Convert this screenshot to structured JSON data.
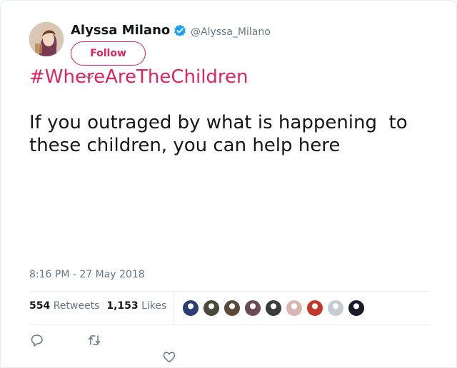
{
  "tweet": {
    "author_name": "Alyssa Milano",
    "handle": "@Alyssa_Milano",
    "follow_label": "Follow",
    "hashtag": "#WhereAreTheChildren",
    "text": "If you outraged by what is happening  to these children, you can help here",
    "timestamp": "8:16 PM - 27 May 2018",
    "retweets_count": "554",
    "retweets_label": "Retweets",
    "likes_count": "1,153",
    "likes_label": "Likes"
  },
  "colors": {
    "accent": "#e0245e",
    "verified": "#1da1f2",
    "muted": "#657786"
  },
  "likers": [
    {
      "name": "liker-avatar-1",
      "color": "#2b3f73"
    },
    {
      "name": "liker-avatar-2",
      "color": "#4a4a3a"
    },
    {
      "name": "liker-avatar-3",
      "color": "#5a4a3a"
    },
    {
      "name": "liker-avatar-4",
      "color": "#6b4a55"
    },
    {
      "name": "liker-avatar-5",
      "color": "#3c3c3c"
    },
    {
      "name": "liker-avatar-6",
      "color": "#d8b7b0"
    },
    {
      "name": "liker-avatar-7",
      "color": "#c0392b"
    },
    {
      "name": "liker-avatar-8",
      "color": "#c4cbd1"
    },
    {
      "name": "liker-avatar-9",
      "color": "#1a1a2a"
    }
  ],
  "icons": {
    "reply": "reply-icon",
    "retweet": "retweet-icon",
    "like": "heart-icon"
  }
}
